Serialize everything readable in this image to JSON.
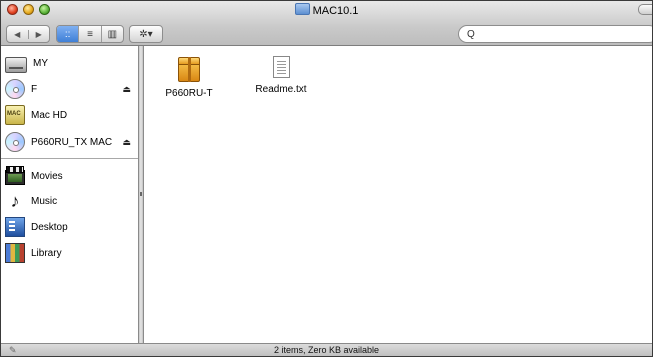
{
  "window": {
    "title": "MAC10.1"
  },
  "toolbar": {
    "back_glyph": "◀",
    "forward_glyph": "▶",
    "view_modes": [
      "icon-view",
      "list-view",
      "column-view"
    ],
    "active_view": "icon-view",
    "action_glyph": "✲▾",
    "search_glyph": "Q",
    "search_value": ""
  },
  "sidebar": {
    "devices": [
      {
        "label": "MY",
        "icon": "hard-drive-icon",
        "eject": ""
      },
      {
        "label": "F",
        "icon": "cd-icon",
        "eject": "⏏"
      },
      {
        "label": "Mac HD",
        "icon": "mac-hd-icon",
        "eject": ""
      },
      {
        "label": "P660RU_TX MAC",
        "icon": "cd-icon",
        "eject": "⏏"
      }
    ],
    "places": [
      {
        "label": "Movies",
        "icon": "movies-icon"
      },
      {
        "label": "Music",
        "icon": "music-icon",
        "glyph": "♪"
      },
      {
        "label": "Desktop",
        "icon": "desktop-icon"
      },
      {
        "label": "Library",
        "icon": "library-icon"
      }
    ]
  },
  "files": [
    {
      "label": "P660RU-T",
      "icon": "package-icon"
    },
    {
      "label": "Readme.txt",
      "icon": "text-document-icon"
    }
  ],
  "status": {
    "text": "2 items, Zero KB available"
  }
}
